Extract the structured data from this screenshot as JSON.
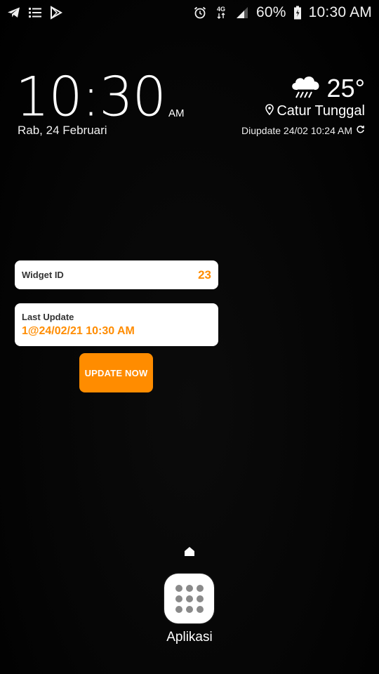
{
  "status_bar": {
    "left_icons": [
      "telegram-icon",
      "list-icon",
      "play-store-icon"
    ],
    "right_icons": [
      "alarm-icon",
      "network-4g-icon",
      "signal-icon",
      "battery-icon"
    ],
    "network_label": "4G",
    "battery_percent": "60%",
    "time": "10:30 AM"
  },
  "clock_widget": {
    "time": "10:30",
    "ampm": "AM",
    "date": "Rab, 24 Februari"
  },
  "weather_widget": {
    "icon": "rain-cloud-icon",
    "temperature": "25°",
    "location": "Catur Tunggal",
    "updated": "Diupdate 24/02 10:24 AM"
  },
  "app_widget": {
    "widget_id_label": "Widget ID",
    "widget_id_value": "23",
    "last_update_label": "Last Update",
    "last_update_value": "1@24/02/21 10:30 AM",
    "update_button_label": "UPDATE NOW"
  },
  "dock": {
    "apps_label": "Aplikasi"
  },
  "colors": {
    "accent": "#ff8c00",
    "background": "#000000",
    "card": "#ffffff"
  }
}
